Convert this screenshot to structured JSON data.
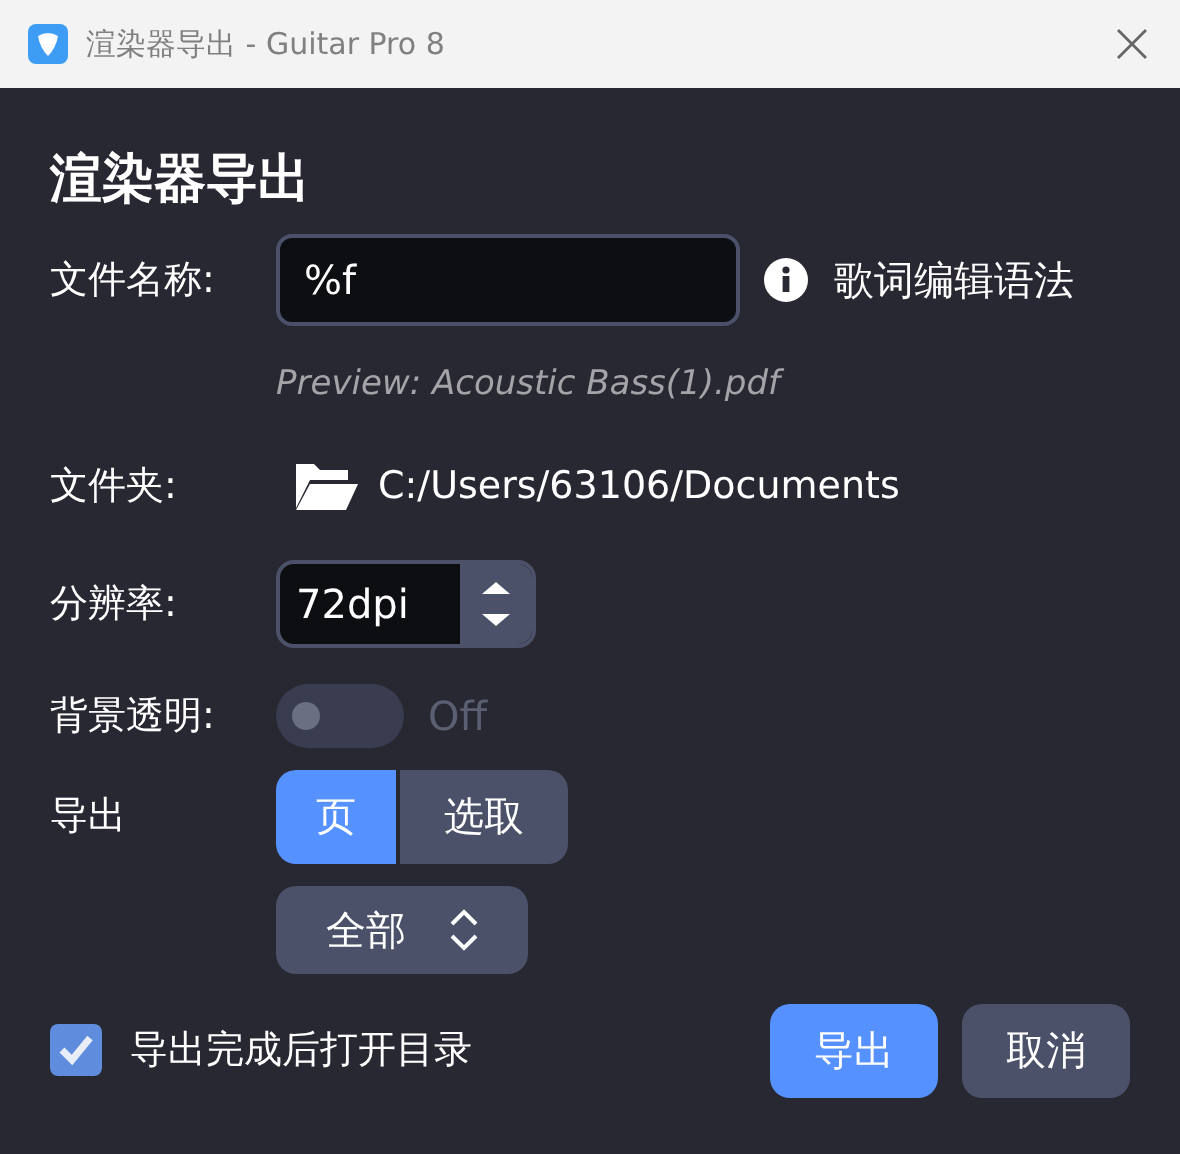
{
  "window": {
    "title": "渲染器导出 - Guitar Pro 8"
  },
  "heading": "渲染器导出",
  "filename": {
    "label": "文件名称:",
    "value": "%f",
    "help_link": "歌词编辑语法",
    "preview": "Preview: Acoustic Bass(1).pdf"
  },
  "folder": {
    "label": "文件夹:",
    "path": "C:/Users/63106/Documents"
  },
  "resolution": {
    "label": "分辨率:",
    "value": "72dpi"
  },
  "transparent_background": {
    "label": "背景透明:",
    "on": false,
    "disabled": true,
    "state_text": "Off"
  },
  "export": {
    "label": "导出",
    "segments": [
      {
        "label": "页",
        "selected": true
      },
      {
        "label": "选取",
        "selected": false
      }
    ],
    "range": "全部"
  },
  "open_folder": {
    "label": "导出完成后打开目录",
    "checked": true
  },
  "buttons": [
    {
      "label": "导出",
      "kind": "primary"
    },
    {
      "label": "取消",
      "kind": "secondary"
    }
  ]
}
